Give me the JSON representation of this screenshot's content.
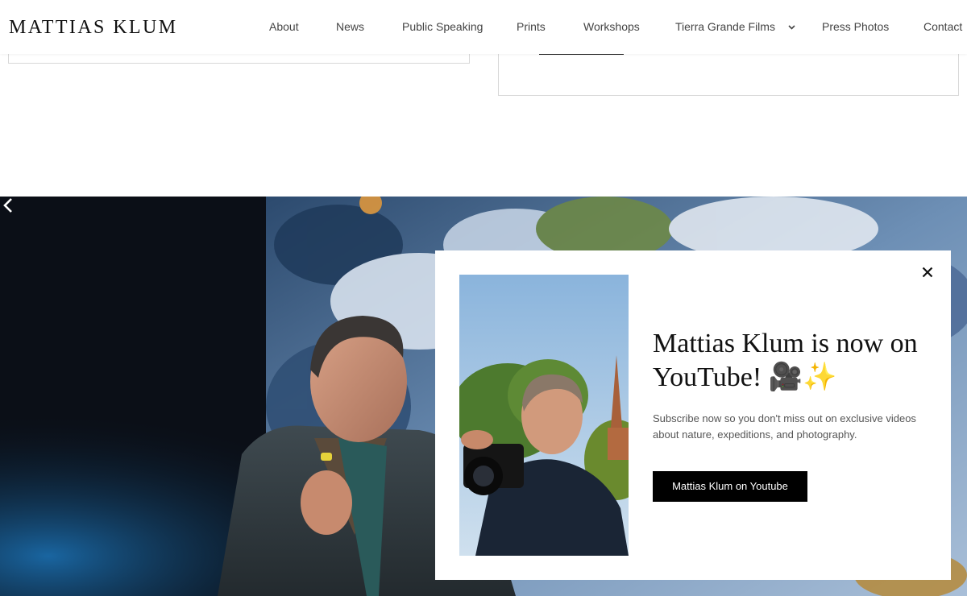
{
  "header": {
    "logo": "MATTIAS KLUM",
    "nav": [
      {
        "label": "About"
      },
      {
        "label": "News"
      },
      {
        "label": "Public Speaking"
      },
      {
        "label": "Prints"
      },
      {
        "label": "Workshops"
      },
      {
        "label": "Tierra Grande Films",
        "has_dropdown": true
      },
      {
        "label": "Press Photos"
      },
      {
        "label": "Contact"
      }
    ]
  },
  "popup": {
    "title": "Mattias Klum is now on YouTube! 🎥✨",
    "text": "Subscribe now so you don't miss out on exclusive videos about nature, expeditions, and photography.",
    "button_label": "Mattias Klum on Youtube",
    "close_icon": "close-icon"
  },
  "hero": {
    "prev_icon": "chevron-left-icon"
  },
  "colors": {
    "button_bg": "#000000",
    "button_text": "#ffffff",
    "text_muted": "#555555"
  }
}
